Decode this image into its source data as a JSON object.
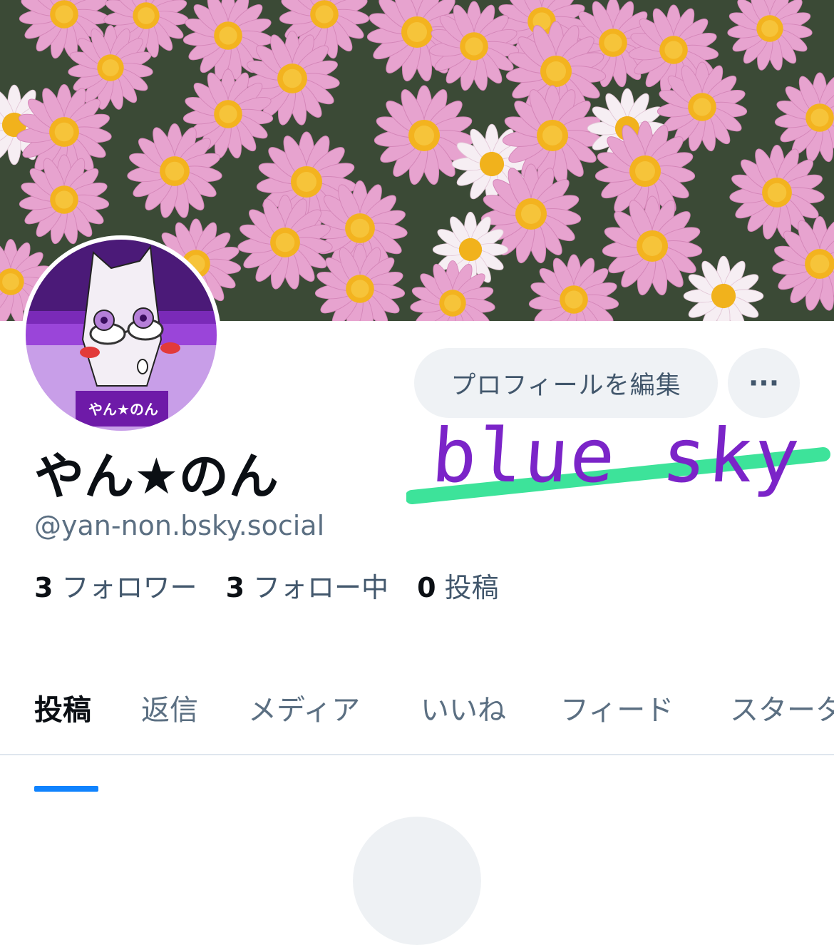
{
  "profile": {
    "display_name": "やん★のん",
    "handle": "@yan-non.bsky.social",
    "avatar_label": "やん★のん",
    "stats": [
      {
        "count": "3",
        "label": "フォロワー"
      },
      {
        "count": "3",
        "label": "フォロー中"
      },
      {
        "count": "0",
        "label": "投稿"
      }
    ]
  },
  "buttons": {
    "edit_profile": "プロフィールを編集",
    "more": "···"
  },
  "overlay": {
    "handwritten_text": "blue sky"
  },
  "tabs": [
    {
      "label": "投稿",
      "active": true
    },
    {
      "label": "返信",
      "active": false
    },
    {
      "label": "メディア",
      "active": false
    },
    {
      "label": "いいね",
      "active": false
    },
    {
      "label": "フィード",
      "active": false
    },
    {
      "label": "スターター",
      "active": false
    }
  ],
  "colors": {
    "accent": "#1083fe",
    "button_bg": "#eff2f5",
    "handwriting": "#7b24c8",
    "strike": "#3de39a"
  }
}
